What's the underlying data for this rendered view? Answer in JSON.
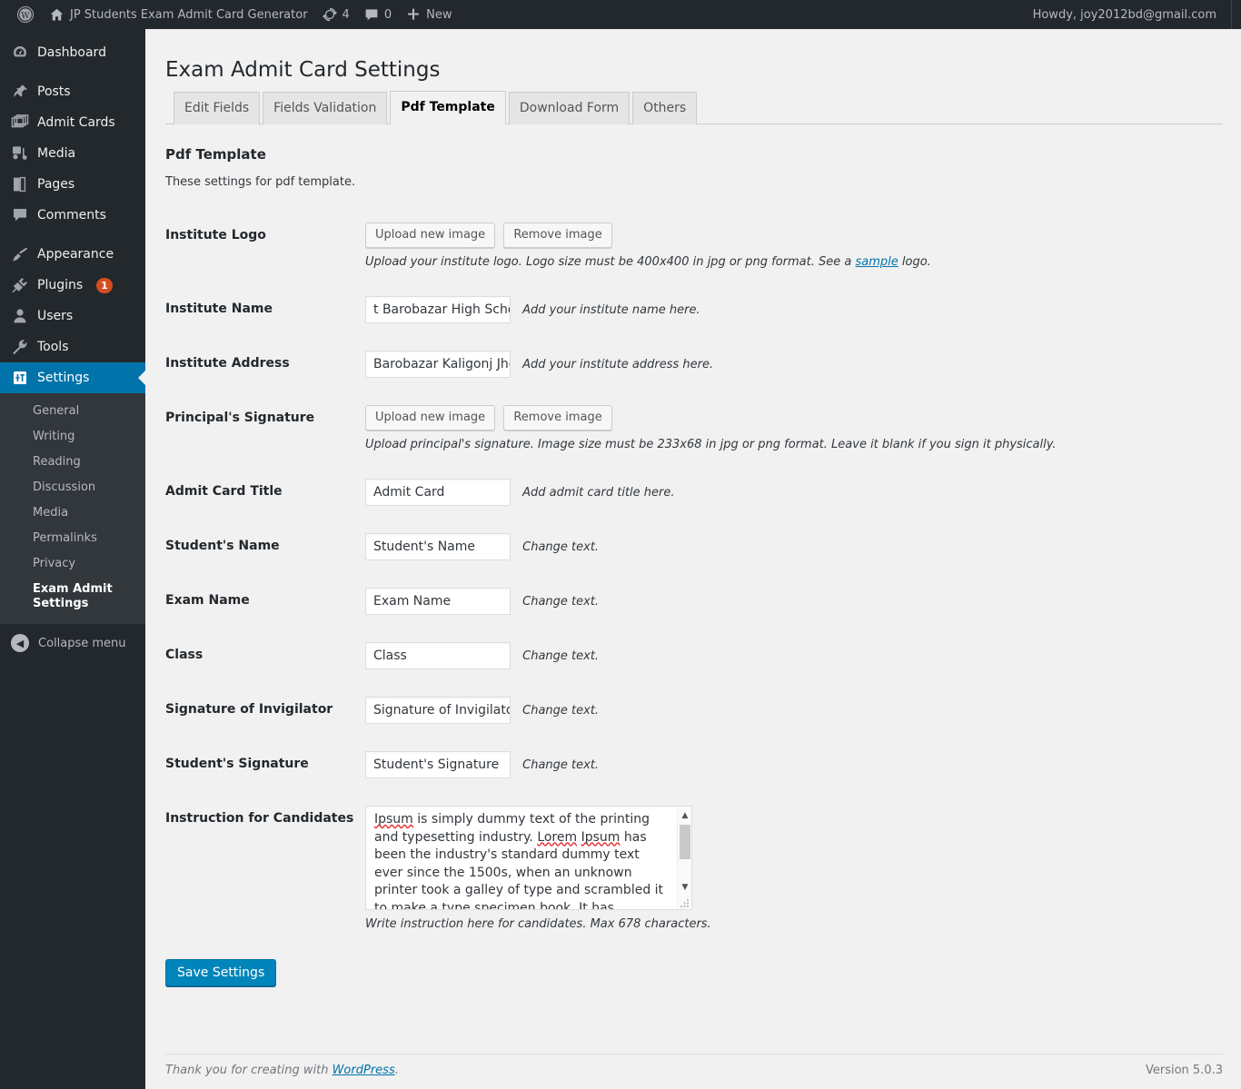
{
  "adminbar": {
    "wp_logo_icon": "wordpress-logo-icon",
    "site_home_icon": "home-icon",
    "site_name": "JP Students Exam Admit Card Generator",
    "updates_icon": "updates-icon",
    "updates_count": "4",
    "comments_icon": "comment-bubble-icon",
    "comments_count": "0",
    "new_icon": "plus-icon",
    "new_label": "New",
    "howdy": "Howdy, joy2012bd@gmail.com"
  },
  "sidebar": {
    "items": [
      {
        "label": "Dashboard",
        "icon": "dashboard-icon",
        "key": "dashboard"
      },
      {
        "label": "Posts",
        "icon": "pin-icon",
        "key": "posts"
      },
      {
        "label": "Admit Cards",
        "icon": "images-icon",
        "key": "admit-cards"
      },
      {
        "label": "Media",
        "icon": "media-icon",
        "key": "media"
      },
      {
        "label": "Pages",
        "icon": "pages-icon",
        "key": "pages"
      },
      {
        "label": "Comments",
        "icon": "comment-bubble-icon",
        "key": "comments"
      },
      {
        "label": "Appearance",
        "icon": "paintbrush-icon",
        "key": "appearance"
      },
      {
        "label": "Plugins",
        "icon": "plug-icon",
        "key": "plugins",
        "badge": "1"
      },
      {
        "label": "Users",
        "icon": "user-icon",
        "key": "users"
      },
      {
        "label": "Tools",
        "icon": "wrench-icon",
        "key": "tools"
      },
      {
        "label": "Settings",
        "icon": "sliders-icon",
        "key": "settings",
        "current": true
      }
    ],
    "submenu": [
      {
        "label": "General"
      },
      {
        "label": "Writing"
      },
      {
        "label": "Reading"
      },
      {
        "label": "Discussion"
      },
      {
        "label": "Media"
      },
      {
        "label": "Permalinks"
      },
      {
        "label": "Privacy"
      },
      {
        "label": "Exam Admit Settings",
        "current": true
      }
    ],
    "collapse_label": "Collapse menu",
    "collapse_icon": "chevron-left-circle-icon",
    "accent_color": "#0073aa",
    "badge_color": "#d54e21"
  },
  "page": {
    "title": "Exam Admit Card Settings",
    "tabs": [
      {
        "label": "Edit Fields",
        "active": false
      },
      {
        "label": "Fields Validation",
        "active": false
      },
      {
        "label": "Pdf Template",
        "active": true
      },
      {
        "label": "Download Form",
        "active": false
      },
      {
        "label": "Others",
        "active": false
      }
    ],
    "section_title": "Pdf Template",
    "section_desc": "These settings for pdf template."
  },
  "form": {
    "institute_logo": {
      "label": "Institute Logo",
      "upload_label": "Upload new image",
      "remove_label": "Remove image",
      "hint_before": "Upload your institute logo. Logo size must be 400x400 in jpg or png format. See a ",
      "hint_link": "sample",
      "hint_after": " logo."
    },
    "institute_name": {
      "label": "Institute Name",
      "value": "t Barobazar High Scholl",
      "hint": "Add your institute name here."
    },
    "institute_address": {
      "label": "Institute Address",
      "value": "Barobazar Kaligonj Jhen",
      "hint": "Add your institute address here."
    },
    "principal_signature": {
      "label": "Principal's Signature",
      "upload_label": "Upload new image",
      "remove_label": "Remove image",
      "hint": "Upload principal's signature. Image size must be 233x68 in jpg or png format. Leave it blank if you sign it physically."
    },
    "admit_card_title": {
      "label": "Admit Card Title",
      "value": "Admit Card",
      "hint": "Add admit card title here."
    },
    "students_name": {
      "label": "Student's Name",
      "value": "Student's Name",
      "hint": "Change text."
    },
    "exam_name": {
      "label": "Exam Name",
      "value": "Exam Name",
      "hint": "Change text."
    },
    "class": {
      "label": "Class",
      "value": "Class",
      "hint": "Change text."
    },
    "signature_invigilator": {
      "label": "Signature of Invigilator",
      "value": "Signature of Invigilator",
      "hint": "Change text."
    },
    "students_signature": {
      "label": "Student's Signature",
      "value": "Student's Signature",
      "hint": "Change text."
    },
    "instruction": {
      "label": "Instruction for Candidates",
      "value": "Ipsum is simply dummy text of the printing and typesetting industry. Lorem Ipsum has been the industry's standard dummy text ever since the 1500s, when an unknown printer took a galley of type and scrambled it to make a type specimen book. It has survived not only five centuries, but also",
      "hint": "Write instruction here for candidates. Max 678 characters.",
      "scroll_up_icon": "chevron-up-icon",
      "scroll_down_icon": "chevron-down-icon",
      "resize_icon": "resize-grip-icon"
    },
    "save_label": "Save Settings"
  },
  "footer": {
    "thanks_before": "Thank you for creating with ",
    "thanks_link": "WordPress",
    "thanks_after": ".",
    "version": "Version 5.0.3"
  }
}
